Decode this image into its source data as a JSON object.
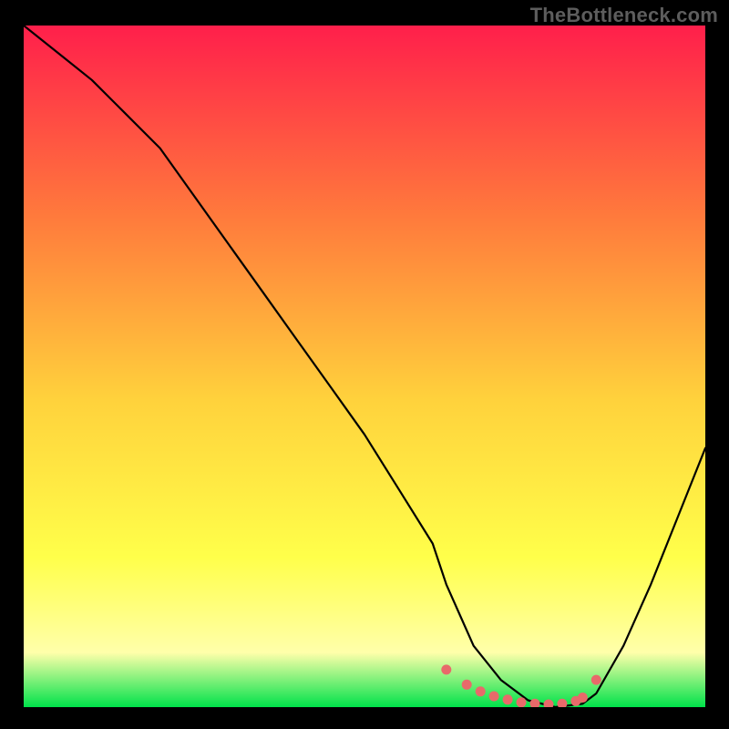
{
  "watermark": "TheBottleneck.com",
  "colors": {
    "gradient_top": "#ff1f4b",
    "gradient_mid1": "#ff7a3c",
    "gradient_mid2": "#ffd23c",
    "gradient_mid3": "#ffff4a",
    "gradient_mid4": "#ffffaa",
    "gradient_bottom": "#00e24a",
    "curve": "#000000",
    "marker": "#e86a6a",
    "background": "#000000"
  },
  "chart_data": {
    "type": "line",
    "title": "",
    "subtitle": "",
    "xlabel": "",
    "ylabel": "",
    "xlim": [
      0,
      100
    ],
    "ylim": [
      0,
      100
    ],
    "grid": false,
    "legend": false,
    "annotations": [],
    "series": [
      {
        "name": "bottleneck-curve",
        "x": [
          0,
          5,
          10,
          15,
          20,
          25,
          30,
          35,
          40,
          45,
          50,
          55,
          60,
          62,
          66,
          70,
          74,
          78,
          82,
          84,
          88,
          92,
          96,
          100
        ],
        "y": [
          100,
          96,
          92,
          87,
          82,
          75,
          68,
          61,
          54,
          47,
          40,
          32,
          24,
          18,
          9,
          4,
          1,
          0,
          0.5,
          2,
          9,
          18,
          28,
          38
        ]
      }
    ],
    "markers": {
      "name": "highlight-dots",
      "x": [
        62,
        65,
        67,
        69,
        71,
        73,
        75,
        77,
        79,
        81,
        82,
        84
      ],
      "y": [
        5.5,
        3.3,
        2.3,
        1.6,
        1.1,
        0.7,
        0.5,
        0.4,
        0.5,
        0.9,
        1.4,
        4.0
      ]
    }
  }
}
